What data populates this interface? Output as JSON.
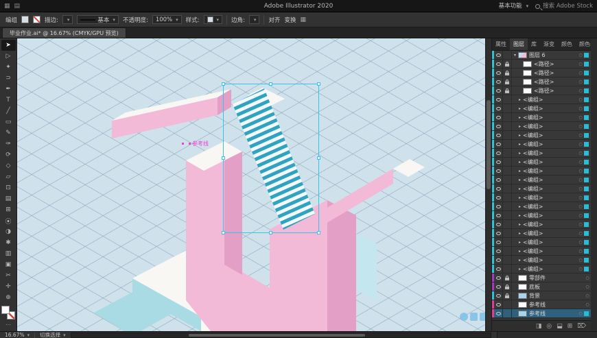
{
  "titlebar": {
    "title": "Adobe Illustrator 2020",
    "workspace_label": "基本功能",
    "search_placeholder": "搜索 Adobe Stock"
  },
  "controlbar": {
    "object_type": "编组",
    "stroke_label": "描边:",
    "brush_label": "基本",
    "opacity_label": "不透明度:",
    "opacity_value": "100%",
    "style_label": "样式:",
    "corner_label": "边角:",
    "align_label": "对齐",
    "transform_label": "变换"
  },
  "document_tab": {
    "title": "毕业作业.ai* @ 16.67% (CMYK/GPU 预览)"
  },
  "toolbar": {
    "tools": [
      {
        "name": "selection-tool",
        "glyph": "➤",
        "active": true
      },
      {
        "name": "direct-selection-tool",
        "glyph": "▷",
        "active": false
      },
      {
        "name": "magic-wand-tool",
        "glyph": "✦",
        "active": false
      },
      {
        "name": "lasso-tool",
        "glyph": "⊃",
        "active": false
      },
      {
        "name": "pen-tool",
        "glyph": "✒",
        "active": false
      },
      {
        "name": "type-tool",
        "glyph": "T",
        "active": false
      },
      {
        "name": "line-segment-tool",
        "glyph": "╱",
        "active": false
      },
      {
        "name": "rectangle-tool",
        "glyph": "▭",
        "active": false
      },
      {
        "name": "paintbrush-tool",
        "glyph": "✎",
        "active": false
      },
      {
        "name": "pencil-tool",
        "glyph": "✑",
        "active": false
      },
      {
        "name": "rotate-tool",
        "glyph": "⟳",
        "active": false
      },
      {
        "name": "scale-tool",
        "glyph": "◇",
        "active": false
      },
      {
        "name": "free-transform-tool",
        "glyph": "▱",
        "active": false
      },
      {
        "name": "shape-builder-tool",
        "glyph": "⊡",
        "active": false
      },
      {
        "name": "gradient-tool",
        "glyph": "▤",
        "active": false
      },
      {
        "name": "mesh-tool",
        "glyph": "⊞",
        "active": false
      },
      {
        "name": "eyedropper-tool",
        "glyph": "⦿",
        "active": false
      },
      {
        "name": "blend-tool",
        "glyph": "◑",
        "active": false
      },
      {
        "name": "symbol-sprayer-tool",
        "glyph": "✱",
        "active": false
      },
      {
        "name": "graph-tool",
        "glyph": "▥",
        "active": false
      },
      {
        "name": "artboard-tool",
        "glyph": "▣",
        "active": false
      },
      {
        "name": "slice-tool",
        "glyph": "✂",
        "active": false
      },
      {
        "name": "hand-tool",
        "glyph": "✛",
        "active": false
      },
      {
        "name": "zoom-tool",
        "glyph": "⊕",
        "active": false
      }
    ]
  },
  "canvas": {
    "guide_label": "参考线",
    "colors": {
      "background": "#cfe2ec",
      "grid": "#7a95b0",
      "pink": "#f3bad7",
      "pink_dark": "#e49fc6",
      "white_face": "#f8f7f4",
      "teal_light": "#c4e6ee",
      "teal_dark": "#a9dbe4",
      "stair_teal": "#2fa3c0",
      "selection": "#35c2ef",
      "guide": "#ee3fd0"
    }
  },
  "layers_panel": {
    "tabs": [
      {
        "id": "properties",
        "label": "属性",
        "active": false
      },
      {
        "id": "layers",
        "label": "图层",
        "active": true
      },
      {
        "id": "libraries",
        "label": "库",
        "active": false
      },
      {
        "id": "gradient",
        "label": "渐变",
        "active": false
      },
      {
        "id": "color",
        "label": "颜色",
        "active": false
      },
      {
        "id": "color-guide",
        "label": "颜色参",
        "active": false
      }
    ],
    "target_glyph": "○",
    "rows": [
      {
        "label": "图层 6",
        "indent": 0,
        "chevron": "▾",
        "eye": true,
        "lock": false,
        "thumb": "art",
        "color": "#2bc5d9",
        "chip": true,
        "selected": false
      },
      {
        "label": "<路径>",
        "indent": 1,
        "chevron": "",
        "eye": true,
        "lock": true,
        "thumb": "white",
        "color": "#2bc5d9",
        "chip": true,
        "selected": false
      },
      {
        "label": "<路径>",
        "indent": 1,
        "chevron": "",
        "eye": true,
        "lock": true,
        "thumb": "white",
        "color": "#2bc5d9",
        "chip": true,
        "selected": false
      },
      {
        "label": "<路径>",
        "indent": 1,
        "chevron": "",
        "eye": true,
        "lock": true,
        "thumb": "white",
        "color": "#2bc5d9",
        "chip": true,
        "selected": false
      },
      {
        "label": "<路径>",
        "indent": 1,
        "chevron": "",
        "eye": true,
        "lock": true,
        "thumb": "white",
        "color": "#2bc5d9",
        "chip": true,
        "selected": false
      },
      {
        "label": "<编组>",
        "indent": 1,
        "chevron": "▸",
        "eye": true,
        "lock": false,
        "thumb": "",
        "color": "#2bc5d9",
        "chip": true,
        "selected": false
      },
      {
        "label": "<编组>",
        "indent": 1,
        "chevron": "▸",
        "eye": true,
        "lock": false,
        "thumb": "",
        "color": "#2bc5d9",
        "chip": true,
        "selected": false
      },
      {
        "label": "<编组>",
        "indent": 1,
        "chevron": "▸",
        "eye": true,
        "lock": false,
        "thumb": "",
        "color": "#2bc5d9",
        "chip": true,
        "selected": false
      },
      {
        "label": "<编组>",
        "indent": 1,
        "chevron": "▸",
        "eye": true,
        "lock": false,
        "thumb": "",
        "color": "#2bc5d9",
        "chip": true,
        "selected": false
      },
      {
        "label": "<编组>",
        "indent": 1,
        "chevron": "▸",
        "eye": true,
        "lock": false,
        "thumb": "",
        "color": "#2bc5d9",
        "chip": true,
        "selected": false
      },
      {
        "label": "<编组>",
        "indent": 1,
        "chevron": "▸",
        "eye": true,
        "lock": false,
        "thumb": "",
        "color": "#2bc5d9",
        "chip": true,
        "selected": false
      },
      {
        "label": "<编组>",
        "indent": 1,
        "chevron": "▸",
        "eye": true,
        "lock": false,
        "thumb": "",
        "color": "#2bc5d9",
        "chip": true,
        "selected": false
      },
      {
        "label": "<编组>",
        "indent": 1,
        "chevron": "▸",
        "eye": true,
        "lock": false,
        "thumb": "",
        "color": "#2bc5d9",
        "chip": true,
        "selected": false
      },
      {
        "label": "<编组>",
        "indent": 1,
        "chevron": "▸",
        "eye": true,
        "lock": false,
        "thumb": "",
        "color": "#2bc5d9",
        "chip": true,
        "selected": false
      },
      {
        "label": "<编组>",
        "indent": 1,
        "chevron": "▸",
        "eye": true,
        "lock": false,
        "thumb": "",
        "color": "#2bc5d9",
        "chip": true,
        "selected": false
      },
      {
        "label": "<编组>",
        "indent": 1,
        "chevron": "▸",
        "eye": true,
        "lock": false,
        "thumb": "",
        "color": "#2bc5d9",
        "chip": true,
        "selected": false
      },
      {
        "label": "<编组>",
        "indent": 1,
        "chevron": "▸",
        "eye": true,
        "lock": false,
        "thumb": "",
        "color": "#2bc5d9",
        "chip": true,
        "selected": false
      },
      {
        "label": "<编组>",
        "indent": 1,
        "chevron": "▸",
        "eye": true,
        "lock": false,
        "thumb": "",
        "color": "#2bc5d9",
        "chip": true,
        "selected": false
      },
      {
        "label": "<编组>",
        "indent": 1,
        "chevron": "▸",
        "eye": true,
        "lock": false,
        "thumb": "",
        "color": "#2bc5d9",
        "chip": true,
        "selected": false
      },
      {
        "label": "<编组>",
        "indent": 1,
        "chevron": "▸",
        "eye": true,
        "lock": false,
        "thumb": "",
        "color": "#2bc5d9",
        "chip": true,
        "selected": false
      },
      {
        "label": "<编组>",
        "indent": 1,
        "chevron": "▸",
        "eye": true,
        "lock": false,
        "thumb": "",
        "color": "#2bc5d9",
        "chip": true,
        "selected": false
      },
      {
        "label": "<编组>",
        "indent": 1,
        "chevron": "▸",
        "eye": true,
        "lock": false,
        "thumb": "",
        "color": "#2bc5d9",
        "chip": true,
        "selected": false
      },
      {
        "label": "<编组>",
        "indent": 1,
        "chevron": "▸",
        "eye": true,
        "lock": false,
        "thumb": "",
        "color": "#2bc5d9",
        "chip": true,
        "selected": false
      },
      {
        "label": "<编组>",
        "indent": 1,
        "chevron": "▸",
        "eye": true,
        "lock": false,
        "thumb": "",
        "color": "#2bc5d9",
        "chip": true,
        "selected": false
      },
      {
        "label": "<编组>",
        "indent": 1,
        "chevron": "▸",
        "eye": true,
        "lock": false,
        "thumb": "",
        "color": "#2bc5d9",
        "chip": true,
        "selected": false
      },
      {
        "label": "零部件",
        "indent": 0,
        "chevron": "",
        "eye": true,
        "lock": true,
        "thumb": "white",
        "color": "#a33bbf",
        "chip": false,
        "selected": false
      },
      {
        "label": "底板",
        "indent": 0,
        "chevron": "",
        "eye": true,
        "lock": true,
        "thumb": "white",
        "color": "#a33bbf",
        "chip": false,
        "selected": false
      },
      {
        "label": "背景",
        "indent": 0,
        "chevron": "",
        "eye": true,
        "lock": true,
        "thumb": "blue",
        "color": "#2bc5d9",
        "chip": false,
        "selected": false
      },
      {
        "label": "参考线",
        "indent": 0,
        "chevron": "",
        "eye": true,
        "lock": false,
        "thumb": "white",
        "color": "#e23d96",
        "chip": false,
        "selected": false
      },
      {
        "label": "参考线",
        "indent": 0,
        "chevron": "",
        "eye": true,
        "lock": false,
        "thumb": "blue",
        "color": "#e23d96",
        "chip": true,
        "selected": true
      }
    ],
    "bottom_icons": [
      {
        "name": "make-clip-mask-icon",
        "glyph": "◨"
      },
      {
        "name": "locate-object-icon",
        "glyph": "◎"
      },
      {
        "name": "new-sublayer-icon",
        "glyph": "⬓"
      },
      {
        "name": "new-layer-icon",
        "glyph": "⊞"
      },
      {
        "name": "delete-layer-icon",
        "glyph": "⌦"
      }
    ]
  },
  "statusbar": {
    "zoom": "16.67%",
    "tool_hint": "切换选择"
  }
}
